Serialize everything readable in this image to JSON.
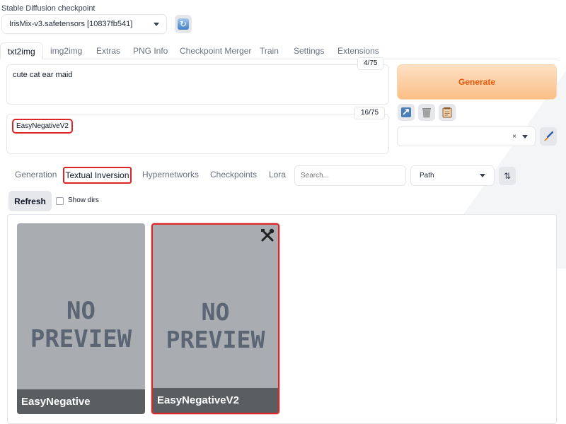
{
  "checkpoint": {
    "label": "Stable Diffusion checkpoint",
    "value": "IrisMix-v3.safetensors [10837fb541]",
    "refresh_icon": "refresh-icon"
  },
  "main_tabs": [
    "txt2img",
    "img2img",
    "Extras",
    "PNG Info",
    "Checkpoint Merger",
    "Train",
    "Settings",
    "Extensions"
  ],
  "prompt": {
    "text": "cute cat ear maid",
    "count": "4/75"
  },
  "negative_prompt": {
    "text": "EasyNegativeV2",
    "count": "16/75"
  },
  "generate_label": "Generate",
  "tool_icons": [
    "paste-icon",
    "trash-icon",
    "clipboard-icon"
  ],
  "style_select": {
    "clear": "×"
  },
  "extra_tabs": [
    "Generation",
    "Textual Inversion",
    "Hypernetworks",
    "Checkpoints",
    "Lora"
  ],
  "search_placeholder": "Search...",
  "sort": {
    "value": "Path",
    "direction_icon": "sort-direction-icon"
  },
  "refresh_label": "Refresh",
  "show_dirs_label": "Show dirs",
  "cards": [
    {
      "name": "EasyNegative",
      "preview_text": [
        "NO",
        "PREVIEW"
      ],
      "selected": false
    },
    {
      "name": "EasyNegativeV2",
      "preview_text": [
        "NO",
        "PREVIEW"
      ],
      "selected": true
    }
  ],
  "colors": {
    "accent": "#ea580c",
    "highlight": "#dc2626",
    "card_bg": "#a9adb1"
  }
}
